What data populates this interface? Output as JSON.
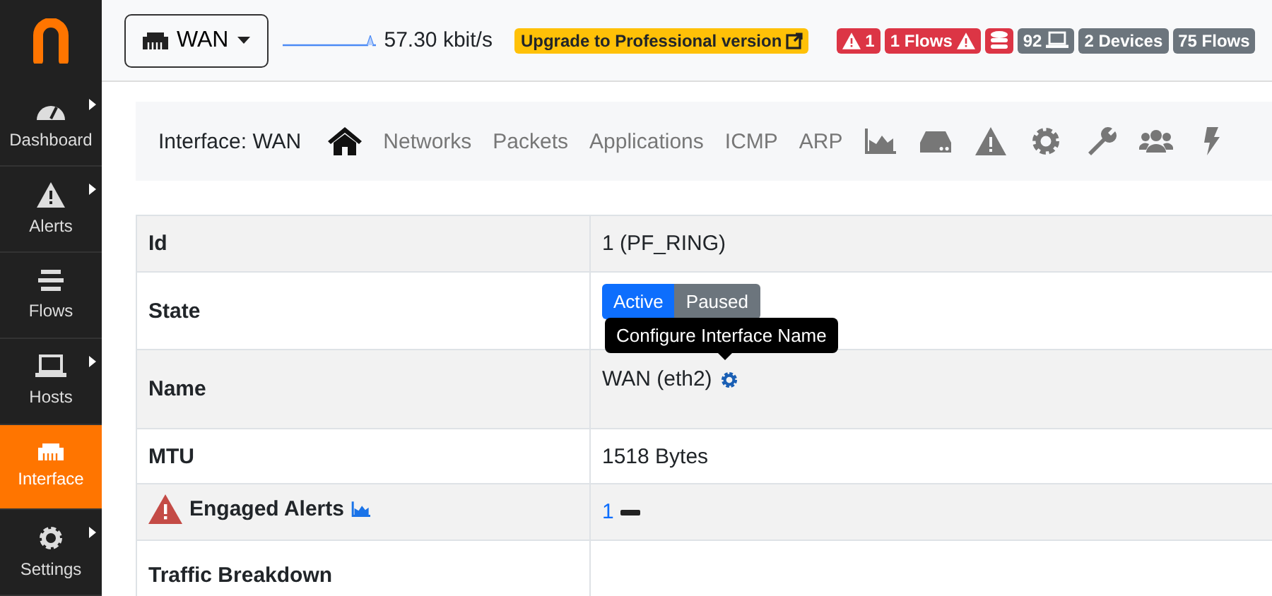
{
  "sidebar": {
    "items": [
      {
        "label": "Dashboard",
        "kind": "gauge",
        "has_submenu": true,
        "selected": false
      },
      {
        "label": "Alerts",
        "kind": "alert",
        "has_submenu": true,
        "selected": false
      },
      {
        "label": "Flows",
        "kind": "flows",
        "has_submenu": false,
        "selected": false
      },
      {
        "label": "Hosts",
        "kind": "laptop",
        "has_submenu": true,
        "selected": false
      },
      {
        "label": "Interface",
        "kind": "ethernet",
        "has_submenu": false,
        "selected": true
      },
      {
        "label": "Settings",
        "kind": "gear",
        "has_submenu": true,
        "selected": false
      }
    ]
  },
  "topbar": {
    "interface_select": "WAN",
    "throughput": "57.30 kbit/s",
    "upgrade": "Upgrade to Professional version",
    "badges": [
      {
        "kind": "alerts",
        "text": "1",
        "color": "#dc3545"
      },
      {
        "kind": "flow-alerts",
        "text": "1 Flows",
        "color": "#dc3545"
      },
      {
        "kind": "database",
        "color": "#dc3545"
      },
      {
        "kind": "hosts",
        "text": "92",
        "color": "#6c757d"
      },
      {
        "kind": "devices",
        "text": "2 Devices",
        "color": "#6c757d"
      },
      {
        "kind": "flows",
        "text": "75 Flows",
        "color": "#6c757d"
      }
    ]
  },
  "nav": {
    "title": "Interface: WAN",
    "items": [
      {
        "kind": "home",
        "selected": true
      },
      {
        "kind": "text",
        "label": "Networks",
        "selected": false
      },
      {
        "kind": "text",
        "label": "Packets",
        "selected": false
      },
      {
        "kind": "text",
        "label": "Applications",
        "selected": false
      },
      {
        "kind": "text",
        "label": "ICMP",
        "selected": false
      },
      {
        "kind": "text",
        "label": "ARP",
        "selected": false
      },
      {
        "kind": "chart",
        "selected": false
      },
      {
        "kind": "disk",
        "selected": false
      },
      {
        "kind": "alert",
        "selected": false
      },
      {
        "kind": "gear",
        "selected": false
      },
      {
        "kind": "wrench",
        "selected": false
      },
      {
        "kind": "users",
        "selected": false
      },
      {
        "kind": "bolt",
        "selected": false
      }
    ]
  },
  "table": {
    "rows": [
      {
        "kind": "text",
        "label": "Id",
        "value": "1 (PF_RING)"
      },
      {
        "kind": "state",
        "label": "State",
        "buttons": [
          {
            "label": "Active",
            "selected": true
          },
          {
            "label": "Paused",
            "selected": false
          }
        ],
        "tooltip": "Configure Interface Name"
      },
      {
        "kind": "name",
        "label": "Name",
        "value": "WAN (eth2)"
      },
      {
        "kind": "text",
        "label": "MTU",
        "value": "1518 Bytes"
      },
      {
        "kind": "alerts",
        "label": "Engaged Alerts",
        "value": "1"
      },
      {
        "kind": "text",
        "label": "Traffic Breakdown"
      }
    ]
  }
}
